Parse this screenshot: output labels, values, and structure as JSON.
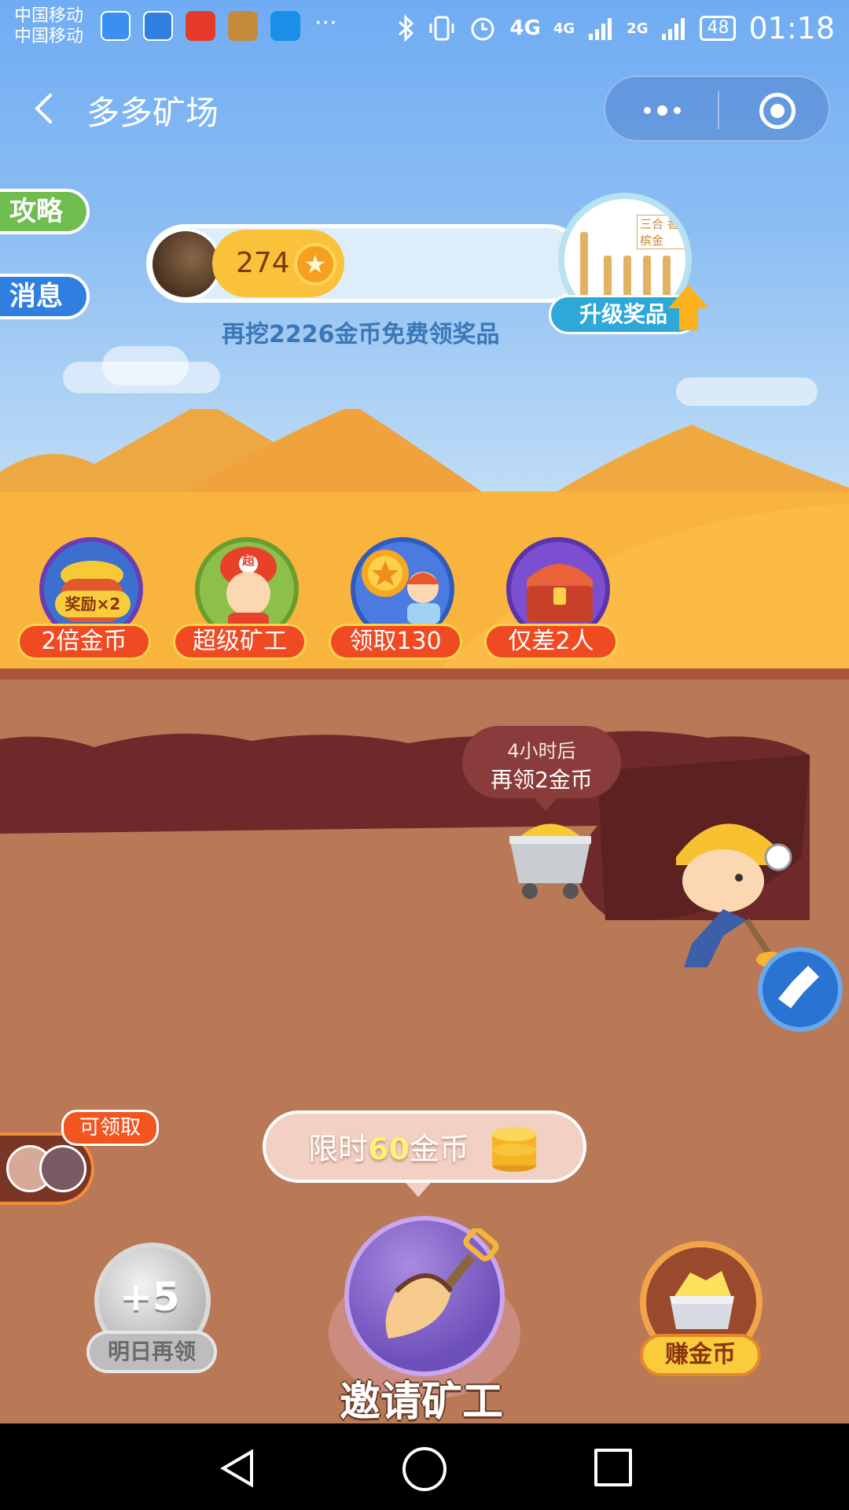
{
  "status_bar": {
    "carrier_1": "中国移动",
    "carrier_2": "中国移动",
    "network_1": "4G",
    "network_2": "4G",
    "network_3": "2G",
    "battery": "48",
    "time": "01:18",
    "more": "···"
  },
  "navbar": {
    "title": "多多矿场"
  },
  "side_tabs": {
    "guide": "攻略",
    "messages": "消息"
  },
  "coins": {
    "count": "274",
    "hint": "再挖2226金币免费领奖品"
  },
  "prize": {
    "tag": "三合 香槟金",
    "upgrade_label": "升级奖品"
  },
  "features": [
    {
      "label": "2倍金币",
      "badge": "奖励×2"
    },
    {
      "label": "超级矿工",
      "badge": "超"
    },
    {
      "label": "领取130"
    },
    {
      "label": "仅差2人"
    }
  ],
  "mine": {
    "bubble_line1": "4小时后",
    "bubble_line2": "再领2金币"
  },
  "invite": {
    "limit_prefix": "限时",
    "limit_amount": "60",
    "limit_suffix": "金币",
    "main_label": "邀请矿工"
  },
  "claim": {
    "tag": "可领取"
  },
  "bottom": {
    "plus": "+5",
    "tomorrow": "明日再领",
    "earn": "赚金币"
  },
  "colors": {
    "sky": "#70acf3",
    "sand": "#f6b23c",
    "ground": "#b97957",
    "accent_red": "#ef4a22",
    "invite_purple": "#6d4fb9"
  }
}
